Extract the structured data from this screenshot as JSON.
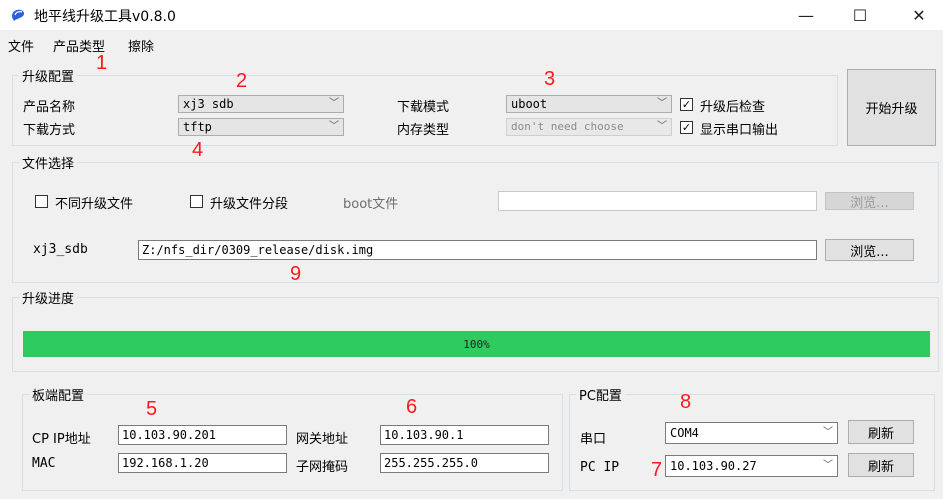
{
  "window": {
    "title": "地平线升级工具v0.8.0",
    "minimize": "—",
    "maximize": "☐",
    "close": "✕"
  },
  "menu": [
    "文件",
    "产品类型",
    "擦除"
  ],
  "upgrade_config": {
    "legend": "升级配置",
    "product_name_label": "产品名称",
    "product_name_value": "xj3 sdb",
    "download_method_label": "下载方式",
    "download_method_value": "tftp",
    "download_mode_label": "下载模式",
    "download_mode_value": "uboot",
    "memory_type_label": "内存类型",
    "memory_type_value": "don't need choose",
    "check_after_upgrade": "升级后检查",
    "show_serial_output": "显示串口输出",
    "start_button": "开始升级"
  },
  "file_select": {
    "legend": "文件选择",
    "different_files": "不同升级文件",
    "split_files": "升级文件分段",
    "boot_file_label": "boot文件",
    "boot_file_value": "",
    "browse_disabled": "浏览...",
    "image_label": "xj3_sdb",
    "image_path": "Z:/nfs_dir/0309_release/disk.img",
    "browse": "浏览..."
  },
  "progress": {
    "legend": "升级进度",
    "percent": 100,
    "text": "100%"
  },
  "board_config": {
    "legend": "板端配置",
    "cp_ip_label": "CP IP地址",
    "cp_ip": "10.103.90.201",
    "mac_label": "MAC",
    "mac": "192.168.1.20",
    "gateway_label": "网关地址",
    "gateway": "10.103.90.1",
    "netmask_label": "子网掩码",
    "netmask": "255.255.255.0"
  },
  "pc_config": {
    "legend": "PC配置",
    "serial_label": "串口",
    "serial_value": "COM4",
    "pc_ip_label": "PC IP",
    "pc_ip_value": "10.103.90.27",
    "refresh1": "刷新",
    "refresh2": "刷新"
  },
  "annotations": [
    "1",
    "2",
    "3",
    "4",
    "5",
    "6",
    "7",
    "8",
    "9"
  ],
  "colors": {
    "progress_fill": "#2ecc5f",
    "annotation_red": "#ff1a1a"
  }
}
